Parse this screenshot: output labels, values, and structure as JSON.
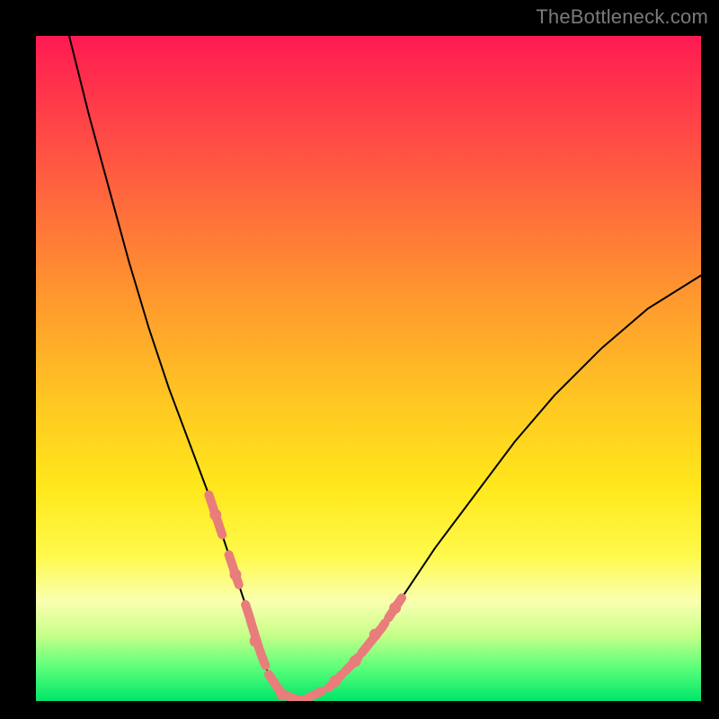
{
  "watermark": "TheBottleneck.com",
  "colors": {
    "gradient_top": "#ff1a52",
    "gradient_mid1": "#ff9a2e",
    "gradient_mid2": "#ffe81c",
    "gradient_bottom": "#00e56a",
    "curve": "#000000",
    "highlight": "#e97d7b",
    "frame": "#000000"
  },
  "chart_data": {
    "type": "line",
    "title": "",
    "xlabel": "",
    "ylabel": "",
    "xlim": [
      0,
      100
    ],
    "ylim": [
      0,
      100
    ],
    "grid": false,
    "legend": false,
    "series": [
      {
        "name": "bottleneck-curve",
        "x": [
          5,
          8,
          11,
          14,
          17,
          20,
          23,
          26,
          28,
          30,
          32,
          33.5,
          35,
          37,
          40,
          44,
          48,
          52,
          56,
          60,
          66,
          72,
          78,
          85,
          92,
          100
        ],
        "y": [
          100,
          88,
          77,
          66,
          56,
          47,
          39,
          31,
          25,
          19,
          13,
          8,
          4,
          1,
          0,
          2,
          6,
          11,
          17,
          23,
          31,
          39,
          46,
          53,
          59,
          64
        ]
      }
    ],
    "highlight_segments": [
      {
        "x_start": 26,
        "x_end": 28
      },
      {
        "x_start": 29,
        "x_end": 30.5
      },
      {
        "x_start": 31.5,
        "x_end": 34.5
      },
      {
        "x_start": 35,
        "x_end": 43
      },
      {
        "x_start": 44,
        "x_end": 46
      },
      {
        "x_start": 46.5,
        "x_end": 48.5
      },
      {
        "x_start": 49,
        "x_end": 52.5
      },
      {
        "x_start": 53,
        "x_end": 55
      }
    ],
    "highlight_points": [
      {
        "x": 27,
        "y": 28
      },
      {
        "x": 30,
        "y": 19
      },
      {
        "x": 33,
        "y": 9
      },
      {
        "x": 37,
        "y": 1
      },
      {
        "x": 40,
        "y": 0
      },
      {
        "x": 45,
        "y": 3
      },
      {
        "x": 48,
        "y": 6
      },
      {
        "x": 51,
        "y": 10
      },
      {
        "x": 54,
        "y": 14
      }
    ],
    "description": "V-shaped bottleneck curve over a red-to-green vertical gradient. Minimum (~0) occurs near x≈40; curve rises steeply to the left to ~100 at x≈5 and more gently to the right reaching ~64 at x=100. Pink beaded segments mark portions of the curve roughly between x≈26 and x≈55."
  }
}
